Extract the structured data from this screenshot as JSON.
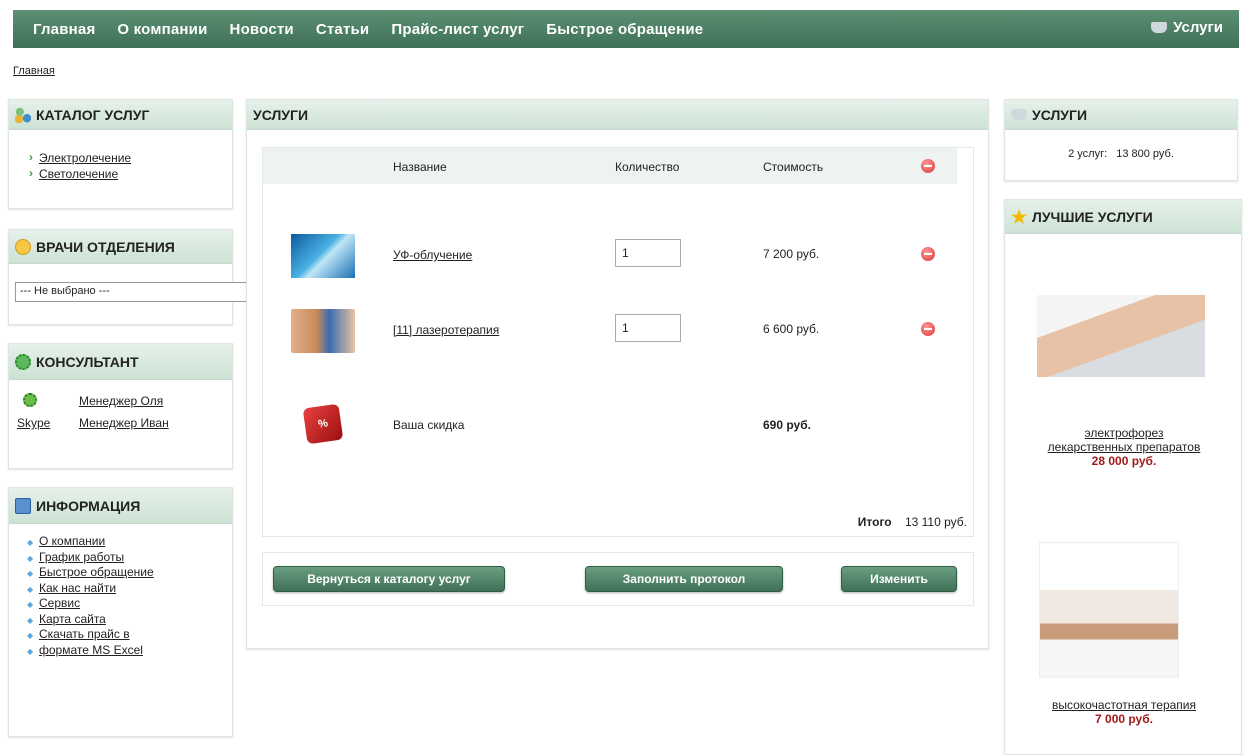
{
  "nav": {
    "items": [
      "Главная",
      "О компании",
      "Новости",
      "Статьи",
      "Прайс-лист услуг",
      "Быстрое обращение"
    ],
    "cart_label": "Услуги"
  },
  "breadcrumb": "Главная",
  "catalog": {
    "title": "КАТАЛОГ УСЛУГ",
    "items": [
      "Электролечение",
      "Светолечение"
    ]
  },
  "doctors": {
    "title": "ВРАЧИ ОТДЕЛЕНИЯ",
    "select_value": "--- Не выбрано ---"
  },
  "consultant": {
    "title": "КОНСУЛЬТАНТ",
    "rows": [
      {
        "left": "",
        "name": "Менеджер Оля"
      },
      {
        "left": "Skype",
        "name": "Менеджер Иван"
      }
    ]
  },
  "info": {
    "title": "ИНФОРМАЦИЯ",
    "items": [
      "О компании",
      "График работы",
      "Быстрое обращение",
      "Как нас найти",
      "Сервис",
      "Карта сайта",
      "Скачать прайс в",
      "формате MS Excel"
    ]
  },
  "main": {
    "title": "УСЛУГИ",
    "headers": {
      "name": "Название",
      "qty": "Количество",
      "cost": "Стоимость"
    },
    "rows": [
      {
        "name": "УФ-облучение",
        "qty": "1",
        "price": "7 200 руб."
      },
      {
        "name": "[11] лазеротерапия",
        "qty": "1",
        "price": "6 600 руб."
      }
    ],
    "discount": {
      "label": "Ваша скидка",
      "value": "690 руб.",
      "dice": "%"
    },
    "total": {
      "label": "Итого",
      "value": "13 110 руб."
    },
    "buttons": {
      "back": "Вернуться к каталогу услуг",
      "protocol": "Заполнить протокол",
      "change": "Изменить"
    }
  },
  "summary": {
    "title": "УСЛУГИ",
    "count": "2 услуг:",
    "sum": "13 800 руб."
  },
  "best": {
    "title": "ЛУЧШИЕ УСЛУГИ",
    "items": [
      {
        "name1": "электрофорез",
        "name2": "лекарственных препаратов",
        "price": "28 000 руб."
      },
      {
        "name1": "высокочастотная терапия",
        "name2": "",
        "price": "7 000 руб."
      }
    ]
  },
  "colors": {
    "nav_bg": "#3f7157",
    "panel_head": "#cde2d5",
    "price_red": "#a01818"
  }
}
